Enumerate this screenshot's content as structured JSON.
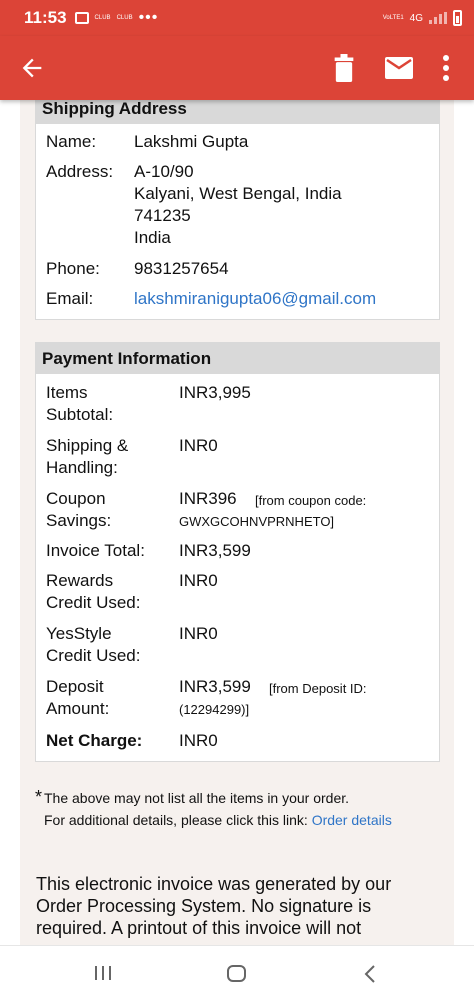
{
  "status_bar": {
    "time": "11:53",
    "club1": "CLUB",
    "club2": "CLUB",
    "more": "•••",
    "net1": "VoLTE1",
    "net2": "4G"
  },
  "shipping": {
    "header": "Shipping Address",
    "name_label": "Name:",
    "name_value": "Lakshmi Gupta",
    "address_label": "Address:",
    "address_lines": [
      "A-10/90",
      "Kalyani, West Bengal, India",
      "741235",
      "India"
    ],
    "phone_label": "Phone:",
    "phone_value": "9831257654",
    "email_label": "Email:",
    "email_value": "lakshmiranigupta06@gmail.com"
  },
  "payment": {
    "header": "Payment Information",
    "items_subtotal_label": [
      "Items",
      "Subtotal:"
    ],
    "items_subtotal_value": "INR3,995",
    "shipping_label": [
      "Shipping &",
      "Handling:"
    ],
    "shipping_value": "INR0",
    "coupon_label": [
      "Coupon",
      "Savings:"
    ],
    "coupon_value": "INR396",
    "coupon_note": "[from coupon code:",
    "coupon_code": "GWXGCOHNVPRNHETO]",
    "invoice_total_label": "Invoice Total:",
    "invoice_total_value": "INR3,599",
    "rewards_label": [
      "Rewards",
      "Credit Used:"
    ],
    "rewards_value": "INR0",
    "yesstyle_label": [
      "YesStyle",
      "Credit Used:"
    ],
    "yesstyle_value": "INR0",
    "deposit_label": [
      "Deposit",
      "Amount:"
    ],
    "deposit_value": "INR3,599",
    "deposit_note": "[from Deposit ID:",
    "deposit_id": "(12294299)]",
    "net_charge_label": "Net Charge:",
    "net_charge_value": "INR0"
  },
  "notes": {
    "asterisk": "*",
    "line1": "The above may not list all the items in your order.",
    "line2": "For additional details, please click this link:",
    "link": "Order details"
  },
  "invoice_text": "This electronic invoice was generated by our Order Processing System. No signature is required. A printout of this invoice will not"
}
